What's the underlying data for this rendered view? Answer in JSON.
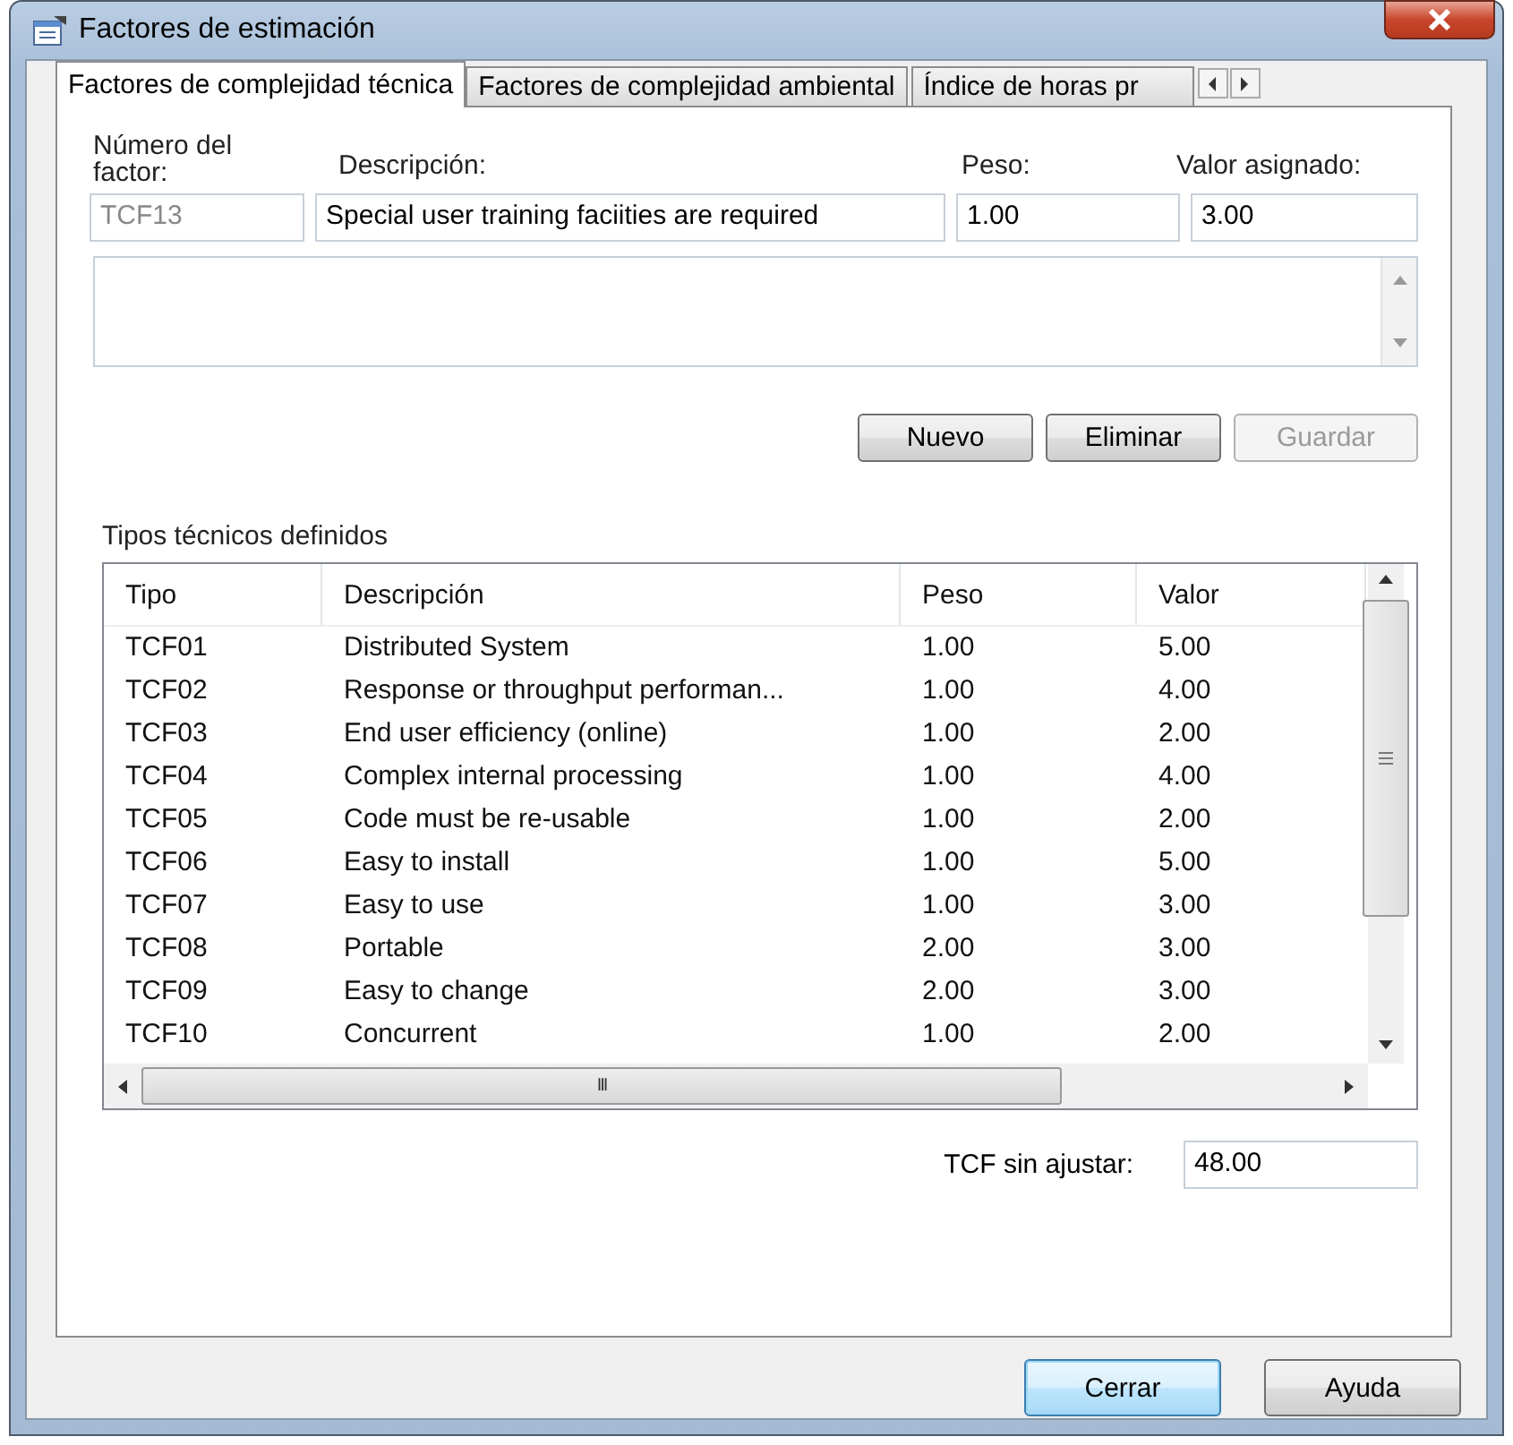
{
  "window": {
    "title": "Factores de estimación"
  },
  "tabs": [
    {
      "label": "Factores de complejidad técnica",
      "selected": true
    },
    {
      "label": "Factores de complejidad ambiental",
      "selected": false
    },
    {
      "label": "Índice de horas pr",
      "selected": false
    }
  ],
  "form": {
    "number_label": "Número del factor:",
    "number_value": "TCF13",
    "number_disabled": true,
    "description_label": "Descripción:",
    "description_value": "Special user training faciities are required",
    "weight_label": "Peso:",
    "weight_value": "1.00",
    "value_label": "Valor asignado:",
    "value_value": "3.00"
  },
  "actions": [
    {
      "label": "Nuevo",
      "disabled": false
    },
    {
      "label": "Eliminar",
      "disabled": false
    },
    {
      "label": "Guardar",
      "disabled": true
    }
  ],
  "table": {
    "title": "Tipos técnicos definidos",
    "columns": [
      "Tipo",
      "Descripción",
      "Peso",
      "Valor"
    ],
    "rows": [
      [
        "TCF01",
        "Distributed System",
        "1.00",
        "5.00"
      ],
      [
        "TCF02",
        "Response or throughput performan...",
        "1.00",
        "4.00"
      ],
      [
        "TCF03",
        "End user efficiency (online)",
        "1.00",
        "2.00"
      ],
      [
        "TCF04",
        "Complex internal processing",
        "1.00",
        "4.00"
      ],
      [
        "TCF05",
        "Code must be re-usable",
        "1.00",
        "2.00"
      ],
      [
        "TCF06",
        "Easy to install",
        "1.00",
        "5.00"
      ],
      [
        "TCF07",
        "Easy to use",
        "1.00",
        "3.00"
      ],
      [
        "TCF08",
        "Portable",
        "2.00",
        "3.00"
      ],
      [
        "TCF09",
        "Easy to change",
        "2.00",
        "3.00"
      ],
      [
        "TCF10",
        "Concurrent",
        "1.00",
        "2.00"
      ]
    ],
    "horizontal_scroll_grip": "III"
  },
  "total": {
    "label": "TCF sin ajustar:",
    "value": "48.00"
  },
  "buttons": [
    {
      "label": "Cerrar",
      "default": true
    },
    {
      "label": "Ayuda",
      "default": false
    }
  ]
}
